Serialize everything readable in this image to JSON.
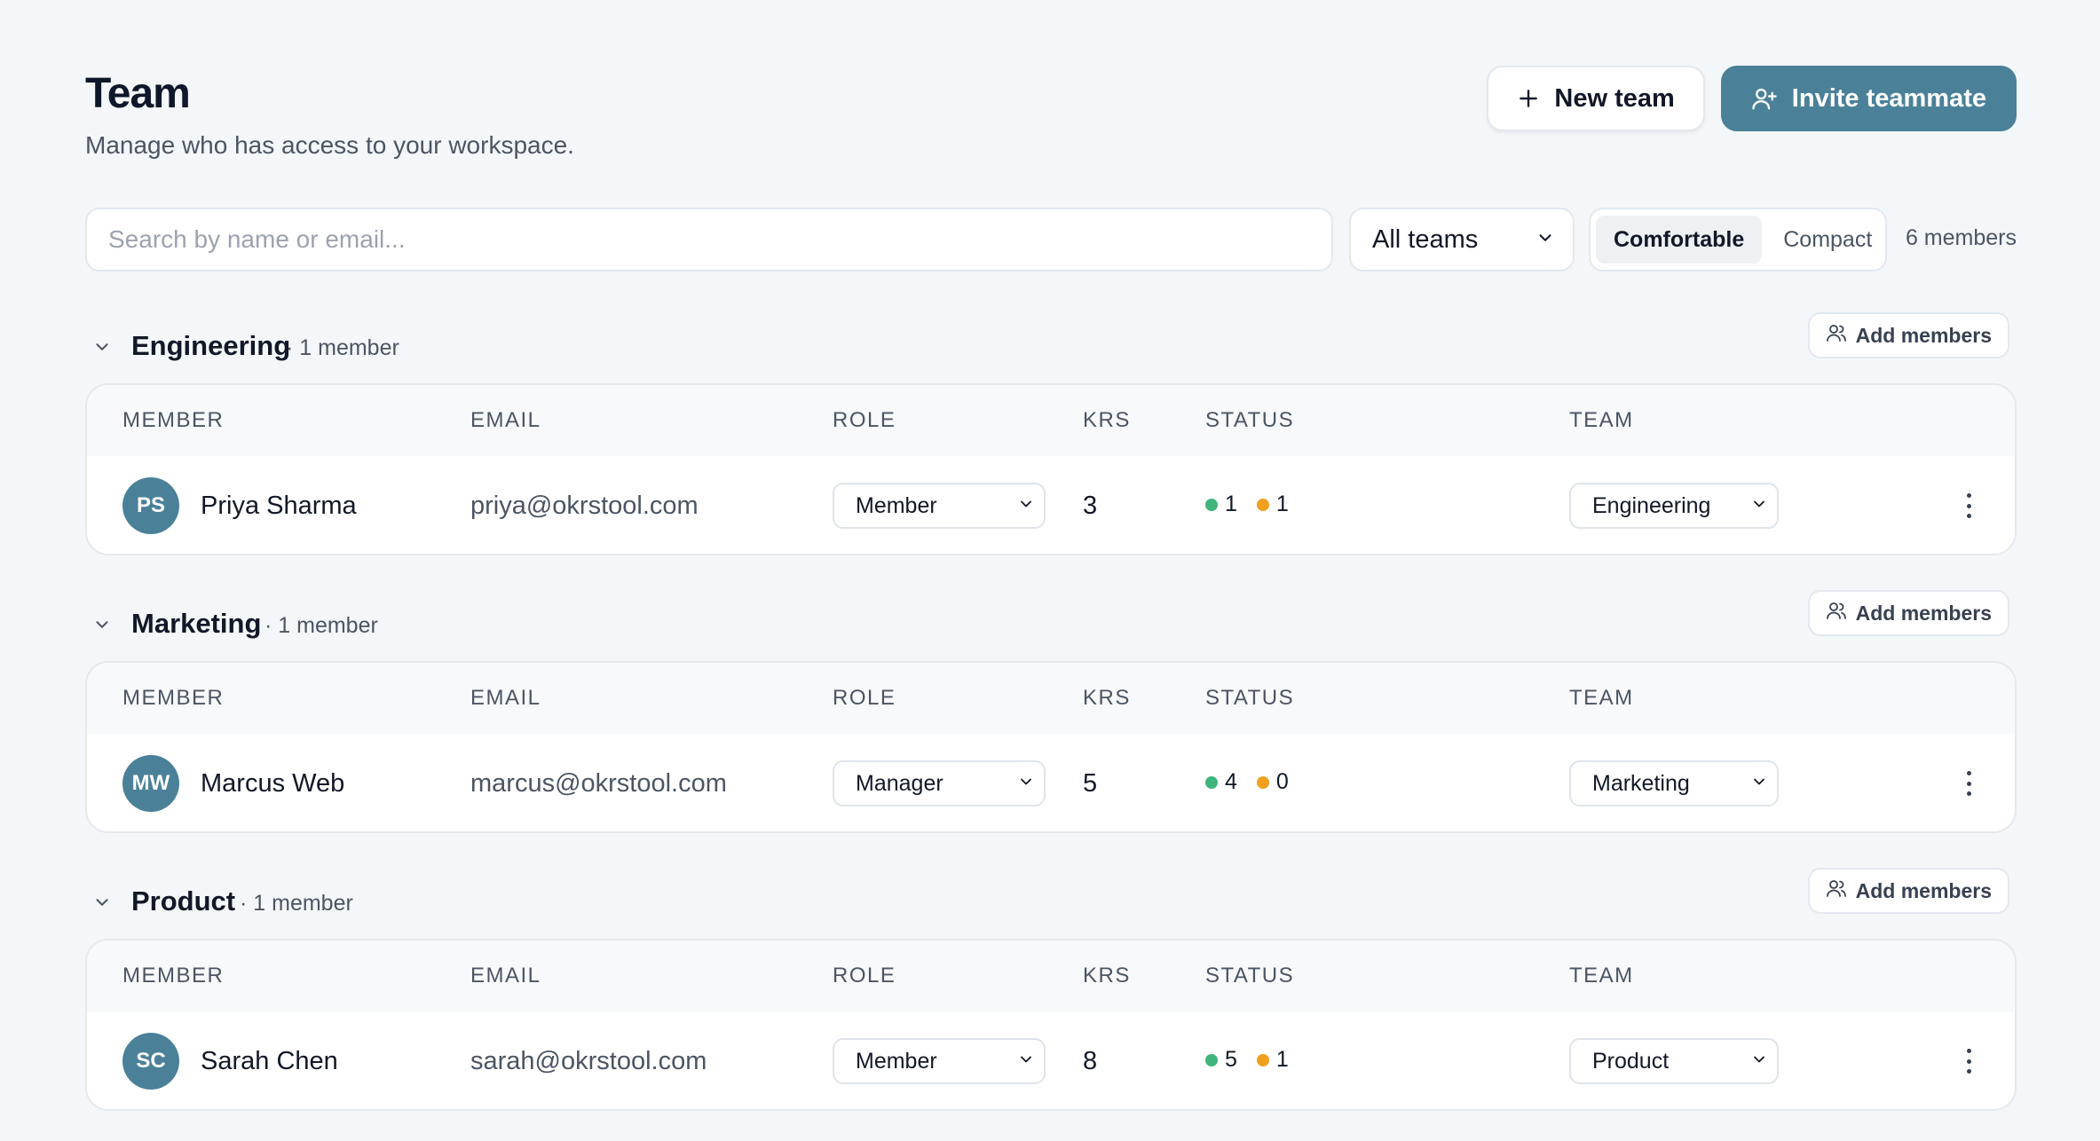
{
  "header": {
    "title": "Team",
    "subtitle": "Manage who has access to your workspace.",
    "new_team_label": "New team",
    "invite_label": "Invite teammate"
  },
  "toolbar": {
    "search_placeholder": "Search by name or email...",
    "team_filter": "All teams",
    "density_options": [
      "Comfortable",
      "Compact"
    ],
    "density_selected": "Comfortable",
    "member_count": "6 members"
  },
  "columns": [
    "MEMBER",
    "EMAIL",
    "ROLE",
    "KRS",
    "STATUS",
    "TEAM"
  ],
  "groups": [
    {
      "name": "Engineering",
      "count": "· 1 member",
      "add_label": "Add members",
      "member": {
        "initials": "PS",
        "name": "Priya Sharma",
        "email": "priya@okrstool.com",
        "role": "Member",
        "krs": "3",
        "status_green": "1",
        "status_orange": "1",
        "team": "Engineering"
      }
    },
    {
      "name": "Marketing",
      "count": "· 1 member",
      "add_label": "Add members",
      "member": {
        "initials": "MW",
        "name": "Marcus Web",
        "email": "marcus@okrstool.com",
        "role": "Manager",
        "krs": "5",
        "status_green": "4",
        "status_orange": "0",
        "team": "Marketing"
      }
    },
    {
      "name": "Product",
      "count": "· 1 member",
      "add_label": "Add members",
      "member": {
        "initials": "SC",
        "name": "Sarah Chen",
        "email": "sarah@okrstool.com",
        "role": "Member",
        "krs": "8",
        "status_green": "5",
        "status_orange": "1",
        "team": "Product"
      }
    }
  ],
  "colors": {
    "accent": "#4a8199",
    "status_green": "#3fb57b",
    "status_orange": "#f0a01e",
    "background": "#f4f7f9"
  }
}
